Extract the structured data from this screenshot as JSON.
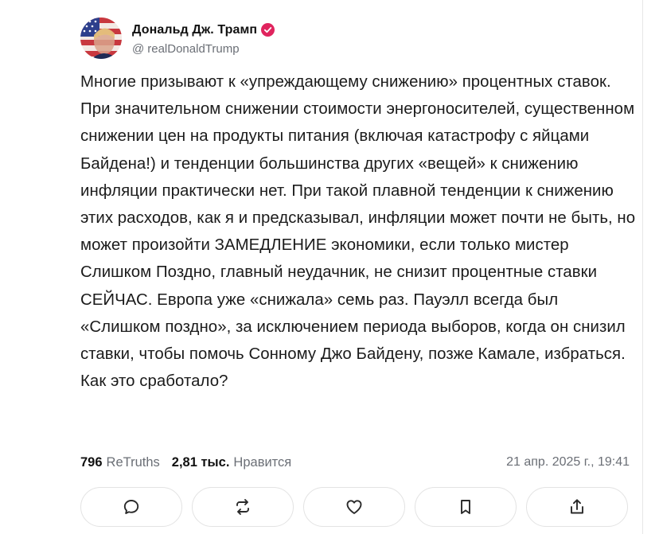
{
  "author": {
    "display_name": "Дональд Дж. Трамп",
    "handle_prefix": "@",
    "handle": "realDonaldTrump",
    "verified": true,
    "avatar_icon": "flag-portrait-avatar"
  },
  "post": {
    "text": "Многие призывают к «упреждающему снижению» процентных ставок. При значительном снижении стоимости энергоносителей, существенном снижении цен на продукты питания (включая катастрофу с яйцами Байдена!) и тенденции большинства других «вещей» к снижению инфляции практически нет. При такой плавной тенденции к снижению этих расходов, как я и предсказывал, инфляции может почти не быть, но может произойти ЗАМЕДЛЕНИЕ экономики, если только мистер Слишком Поздно, главный неудачник, не снизит процентные ставки СЕЙЧАС. Европа уже «снижала» семь раз. Пауэлл всегда был «Слишком поздно», за исключением периода выборов, когда он снизил ставки, чтобы помочь Сонному Джо Байдену, позже Камале, избраться. Как это сработало?"
  },
  "stats": {
    "retruths_count": "796",
    "retruths_label": "ReTruths",
    "likes_count": "2,81 тыс.",
    "likes_label": "Нравится",
    "timestamp": "21 апр. 2025 г., 19:41"
  },
  "actions": [
    {
      "name": "reply-button",
      "icon": "comment-icon"
    },
    {
      "name": "retruth-button",
      "icon": "repost-icon"
    },
    {
      "name": "like-button",
      "icon": "heart-icon"
    },
    {
      "name": "bookmark-button",
      "icon": "bookmark-icon"
    },
    {
      "name": "share-button",
      "icon": "share-icon"
    }
  ],
  "colors": {
    "verified_badge": "#e0245e",
    "muted_text": "#6b6f76",
    "button_border": "#e3e3e3"
  }
}
